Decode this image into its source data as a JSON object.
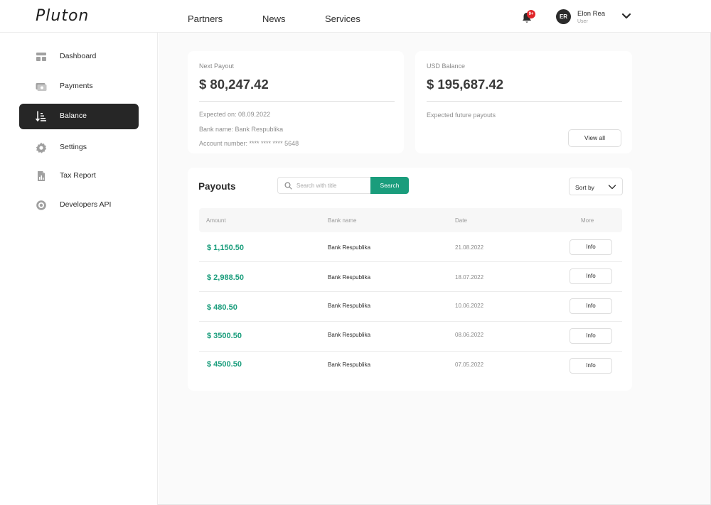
{
  "header": {
    "logo": "Pluton",
    "nav": [
      "Partners",
      "News",
      "Services"
    ],
    "notification_badge": "9+",
    "user": {
      "initials": "ER",
      "name": "Elon Rea",
      "role": "User"
    }
  },
  "sidebar": {
    "items": [
      {
        "label": "Dashboard",
        "icon": "dashboard-icon",
        "active": false
      },
      {
        "label": "Payments",
        "icon": "payments-icon",
        "active": false
      },
      {
        "label": "Balance",
        "icon": "balance-icon",
        "active": true
      },
      {
        "label": "Settings",
        "icon": "gear-icon",
        "active": false
      },
      {
        "label": "Tax Report",
        "icon": "tax-report-icon",
        "active": false
      },
      {
        "label": "Developers API",
        "icon": "developers-api-icon",
        "active": false
      }
    ]
  },
  "next_payout": {
    "label": "Next Payout",
    "amount": "$ 80,247.42",
    "expected_on": "Expected on: 08.09.2022",
    "bank_name": "Bank name: Bank Respublika",
    "account_number": "Account number: **** **** **** 5648"
  },
  "usd_balance": {
    "label": "USD Balance",
    "amount": "$ 195,687.42",
    "note": "Expected future payouts",
    "view_all": "View all"
  },
  "payouts": {
    "title": "Payouts",
    "search_placeholder": "Search with title",
    "search_button": "Search",
    "sort_label": "Sort by",
    "columns": [
      "Amount",
      "Bank name",
      "Date",
      "More"
    ],
    "rows": [
      {
        "amount": "$ 1,150.50",
        "bank": "Bank Respublika",
        "date": "21.08.2022",
        "action": "Info"
      },
      {
        "amount": "$ 2,988.50",
        "bank": "Bank Respublika",
        "date": "18.07.2022",
        "action": "Info"
      },
      {
        "amount": "$ 480.50",
        "bank": "Bank Respublika",
        "date": "10.06.2022",
        "action": "Info"
      },
      {
        "amount": "$ 3500.50",
        "bank": "Bank Respublika",
        "date": "08.06.2022",
        "action": "Info"
      },
      {
        "amount": "$ 4500.50",
        "bank": "Bank Respublika",
        "date": "07.05.2022",
        "action": "Info"
      }
    ]
  },
  "colors": {
    "accent": "#1a9d7c",
    "sidebar_active": "#262626",
    "badge": "#e0262a"
  }
}
